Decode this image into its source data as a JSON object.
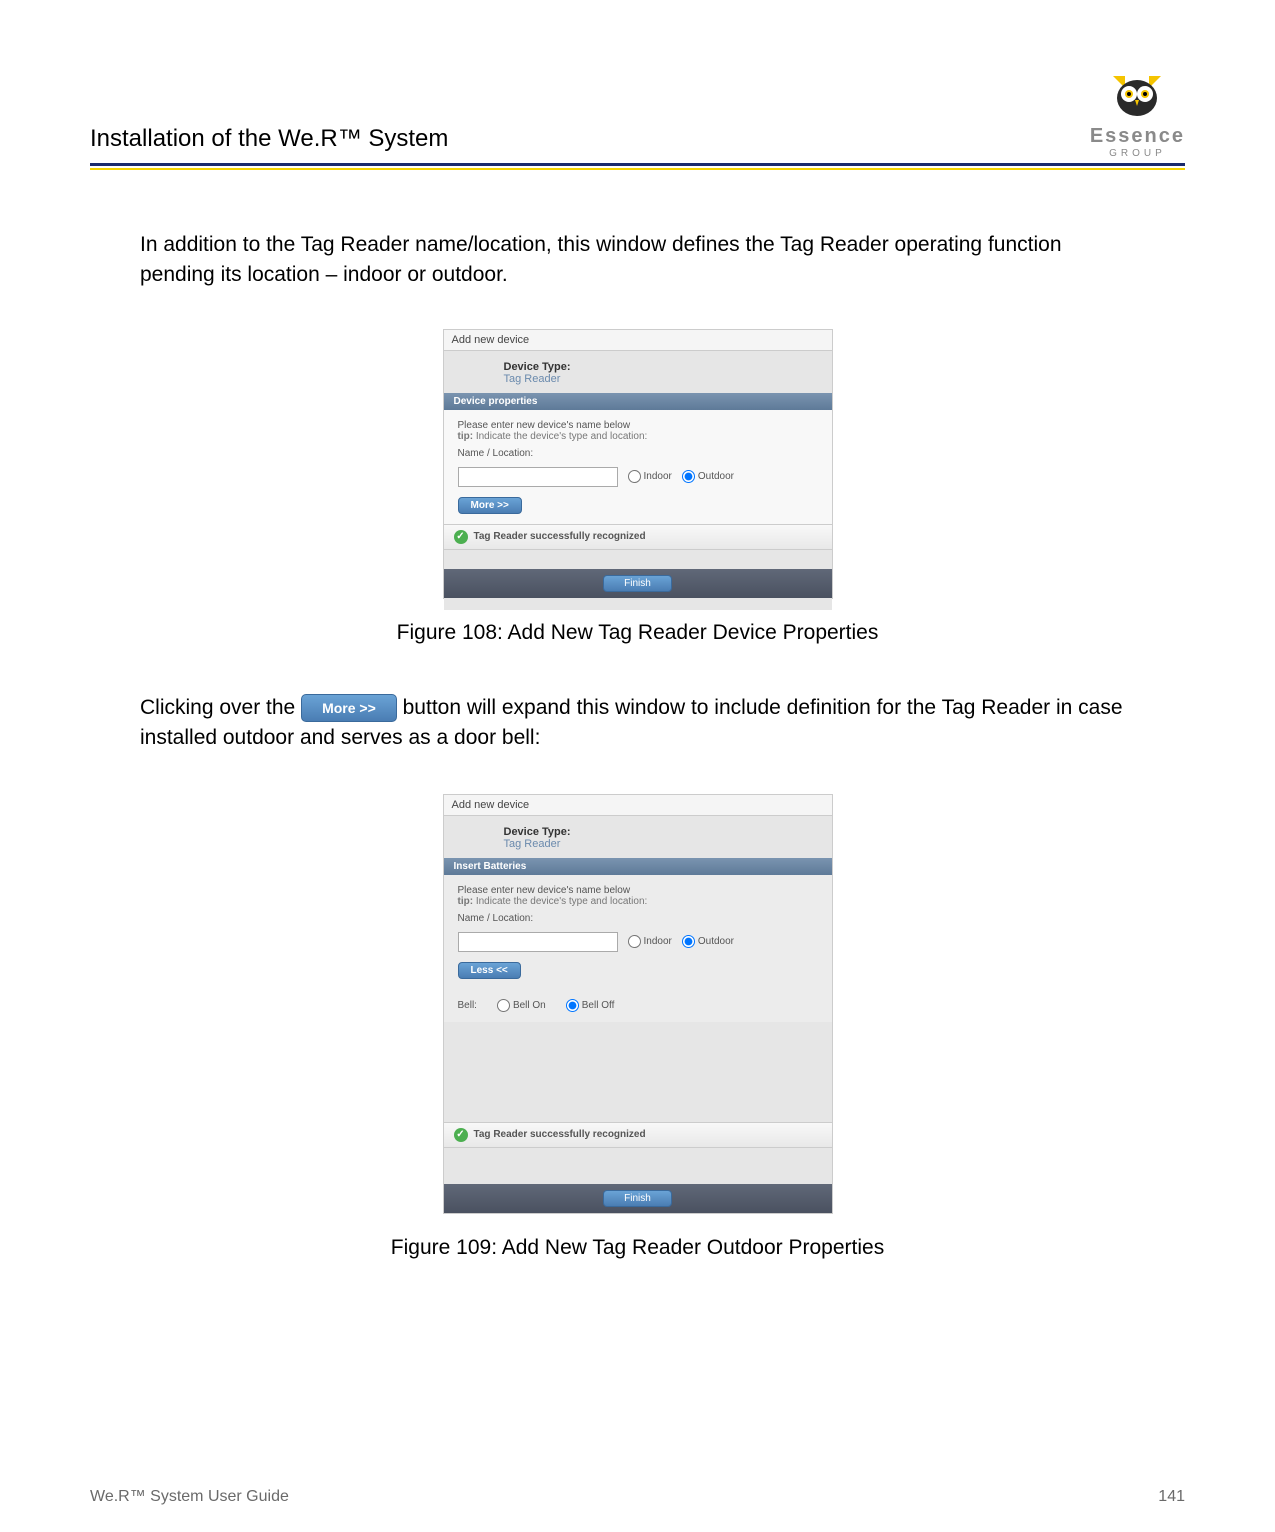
{
  "header": {
    "title": "Installation of the We.R™ System",
    "logo_name": "Essence",
    "logo_sub": "GROUP"
  },
  "body": {
    "para1": "In addition to the Tag Reader name/location, this window defines the Tag Reader operating function pending its location – indoor or outdoor.",
    "fig108_caption": "Figure 108: Add New Tag Reader Device Properties",
    "para2_before": "Clicking over the ",
    "para2_button": "More >>",
    "para2_after": " button will expand this window to include definition for the Tag Reader in case installed outdoor and serves as a door bell:",
    "fig109_caption": "Figure 109: Add New Tag Reader Outdoor Properties"
  },
  "dialog": {
    "title": "Add new device",
    "device_type_label": "Device Type:",
    "device_type_value": "Tag Reader",
    "section_props": "Device properties",
    "section_insert": "Insert Batteries",
    "instr1": "Please enter new device's name below",
    "instr2_prefix": "tip: ",
    "instr2": "Indicate the device's type and location:",
    "name_label": "Name / Location:",
    "indoor": "Indoor",
    "outdoor": "Outdoor",
    "more_btn": "More >>",
    "less_btn": "Less <<",
    "bell_label": "Bell:",
    "bell_on": "Bell On",
    "bell_off": "Bell Off",
    "success": "Tag Reader successfully recognized",
    "finish": "Finish"
  },
  "footer": {
    "left": "We.R™ System User Guide",
    "right": "141"
  }
}
